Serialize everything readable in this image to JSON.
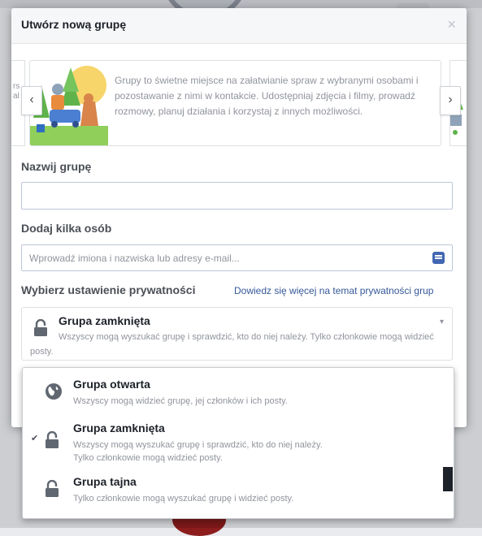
{
  "dialog": {
    "title": "Utwórz nową grupę",
    "close_glyph": "×"
  },
  "intro": {
    "text": "Grupy to świetne miejsce na załatwianie spraw z wybranymi osobami i pozostawanie z nimi w kontakcie. Udostępniaj zdjęcia i filmy, prowadź rozmowy, planuj działania i korzystaj z innych możliwości.",
    "prev_peek_text": "rs\nal",
    "prev_glyph": "‹",
    "next_glyph": "›"
  },
  "name_field": {
    "label": "Nazwij grupę",
    "value": "",
    "placeholder": ""
  },
  "members_field": {
    "label": "Dodaj kilka osób",
    "value": "",
    "placeholder": "Wprowadź imiona i nazwiska lub adresy e-mail..."
  },
  "privacy": {
    "label": "Wybierz ustawienie prywatności",
    "learn_more": "Dowiedz się więcej na temat prywatności grup",
    "selected_title": "Grupa zamknięta",
    "selected_desc": "Wszyscy mogą wyszukać grupę i sprawdzić, kto do niej należy. Tylko członkowie mogą widzieć posty.",
    "caret_glyph": "▾",
    "options": [
      {
        "title": "Grupa otwarta",
        "desc": "Wszyscy mogą widzieć grupę, jej członków i ich posty.",
        "icon": "globe-icon",
        "checked": false
      },
      {
        "title": "Grupa zamknięta",
        "desc": "Wszyscy mogą wyszukać grupę i sprawdzić, kto do niej należy. Tylko członkowie mogą widzieć posty.",
        "icon": "lock-icon",
        "checked": true
      },
      {
        "title": "Grupa tajna",
        "desc": "Tylko członkowie mogą wyszukać grupę i widzieć posty.",
        "icon": "lock-icon",
        "checked": false
      }
    ],
    "check_glyph": "✔"
  },
  "colors": {
    "accent": "#4267b2",
    "link": "#365899",
    "text": "#1d2129",
    "muted": "#90949c"
  }
}
